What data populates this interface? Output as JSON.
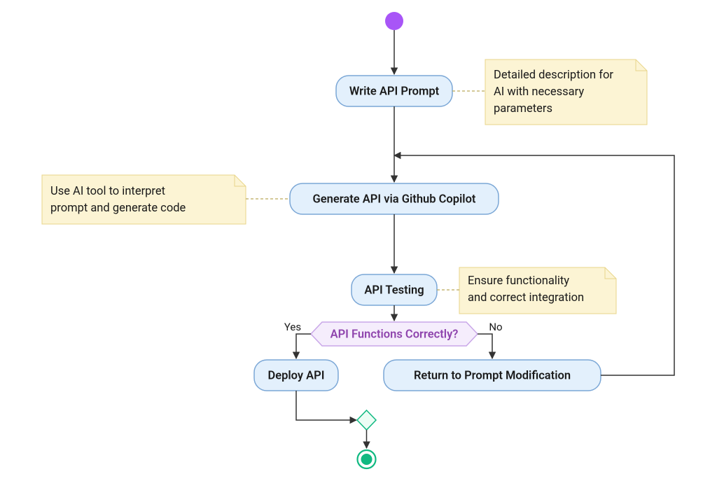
{
  "chart_data": {
    "type": "flowchart",
    "title": "",
    "nodes": [
      {
        "id": "start",
        "kind": "start"
      },
      {
        "id": "write_prompt",
        "kind": "process",
        "label": "Write API Prompt"
      },
      {
        "id": "generate",
        "kind": "process",
        "label": "Generate API via Github Copilot"
      },
      {
        "id": "testing",
        "kind": "process",
        "label": "API Testing"
      },
      {
        "id": "decision",
        "kind": "decision",
        "label": "API Functions Correctly?"
      },
      {
        "id": "deploy",
        "kind": "process",
        "label": "Deploy API"
      },
      {
        "id": "return_mod",
        "kind": "process",
        "label": "Return to Prompt Modification"
      },
      {
        "id": "merge",
        "kind": "merge"
      },
      {
        "id": "end",
        "kind": "end"
      }
    ],
    "edges": [
      {
        "from": "start",
        "to": "write_prompt"
      },
      {
        "from": "write_prompt",
        "to": "generate"
      },
      {
        "from": "generate",
        "to": "testing"
      },
      {
        "from": "testing",
        "to": "decision"
      },
      {
        "from": "decision",
        "to": "deploy",
        "label": "Yes"
      },
      {
        "from": "decision",
        "to": "return_mod",
        "label": "No"
      },
      {
        "from": "deploy",
        "to": "merge"
      },
      {
        "from": "return_mod",
        "to": "generate",
        "loopback": true
      },
      {
        "from": "merge",
        "to": "end"
      }
    ],
    "notes": [
      {
        "attached_to": "write_prompt",
        "text": "Detailed description for AI with necessary parameters"
      },
      {
        "attached_to": "generate",
        "text": "Use AI tool to interpret prompt and generate code"
      },
      {
        "attached_to": "testing",
        "text": "Ensure functionality and correct integration"
      }
    ]
  },
  "labels": {
    "write_prompt": "Write API Prompt",
    "generate": "Generate API via Github Copilot",
    "testing": "API Testing",
    "decision": "API Functions Correctly?",
    "deploy": "Deploy API",
    "return_mod": "Return to Prompt Modification",
    "yes": "Yes",
    "no": "No"
  },
  "notes": {
    "write_prompt_l1": "Detailed description for",
    "write_prompt_l2": "AI with necessary",
    "write_prompt_l3": "parameters",
    "generate_l1": "Use AI tool to interpret",
    "generate_l2": "prompt and generate code",
    "testing_l1": "Ensure functionality",
    "testing_l2": "and correct integration"
  }
}
